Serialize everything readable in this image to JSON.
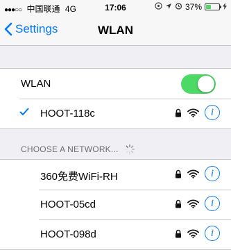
{
  "status_bar": {
    "signal_dots": "●●●○○",
    "carrier": "中国联通",
    "network": "4G",
    "time": "17:06",
    "battery": "37%",
    "battery_level": 0.37,
    "icons": [
      "location-icon",
      "alarm-icon",
      "battery-icon"
    ]
  },
  "nav": {
    "back_label": "Settings",
    "title": "WLAN"
  },
  "wlan": {
    "label": "WLAN",
    "enabled": true,
    "accent": "#4cd964"
  },
  "connected": {
    "name": "HOOT-118c",
    "secured": true
  },
  "section_header": "CHOOSE A NETWORK...",
  "networks": [
    {
      "name": "360免费WiFi-RH",
      "secured": true
    },
    {
      "name": "HOOT-05cd",
      "secured": true
    },
    {
      "name": "HOOT-098d",
      "secured": true
    }
  ],
  "colors": {
    "tint": "#007aff",
    "background": "#efeff4"
  }
}
